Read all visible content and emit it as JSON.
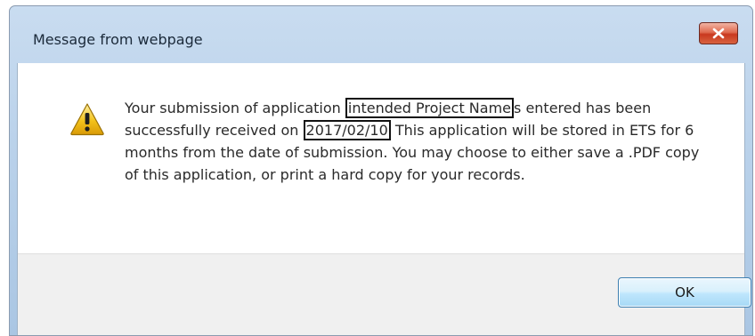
{
  "window": {
    "title": "Message from webpage",
    "close_icon": "close-icon"
  },
  "message": {
    "icon": "warning-icon",
    "part1": "Your submission of application ",
    "project_name": "intended Project Name",
    "part2": "s entered has been successfully received on ",
    "date": "2017/02/10",
    "part3": " This application will be stored in ETS for 6 months from the date of submission. You may choose to either save a .PDF copy of this application, or print a hard copy for your records."
  },
  "buttons": {
    "ok_label": "OK"
  },
  "colors": {
    "title_bar": "#b9d1ea",
    "close_button": "#c9381f",
    "button_bar": "#f0f0f0",
    "ok_border": "#3c7fb1",
    "warning_yellow": "#f3c21a"
  }
}
